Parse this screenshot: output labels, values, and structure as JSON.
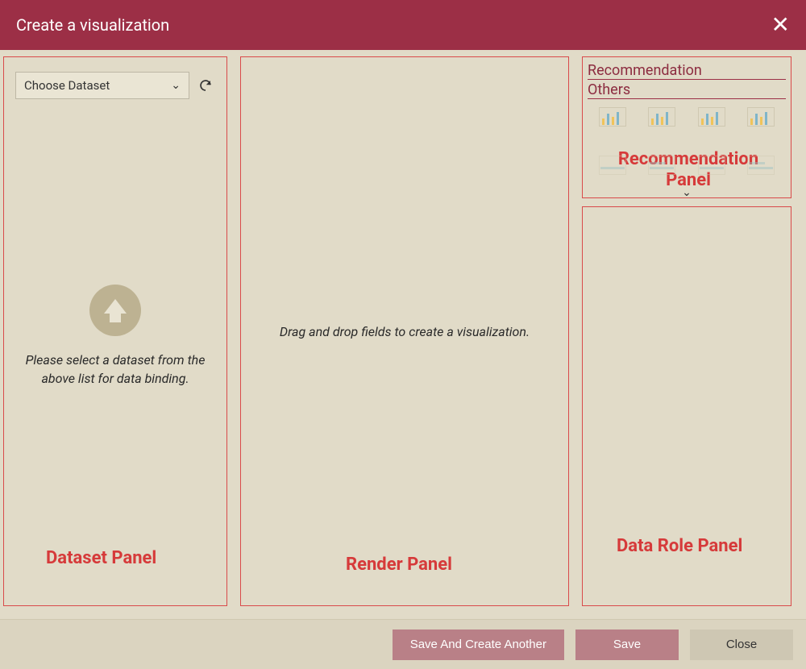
{
  "dialog": {
    "title": "Create a visualization"
  },
  "dataset_panel": {
    "select_label": "Choose Dataset",
    "empty_text": "Please select a dataset from the above list for data binding.",
    "annotation": "Dataset Panel"
  },
  "render_panel": {
    "hint": "Drag and drop fields to create a visualization.",
    "annotation": "Render Panel"
  },
  "recommendation_panel": {
    "heading": "Recommendation",
    "sub_heading": "Others",
    "annotation": "Recommendation Panel"
  },
  "datarole_panel": {
    "annotation": "Data Role Panel"
  },
  "footer": {
    "save_another_label": "Save And Create Another",
    "save_label": "Save",
    "close_label": "Close"
  }
}
